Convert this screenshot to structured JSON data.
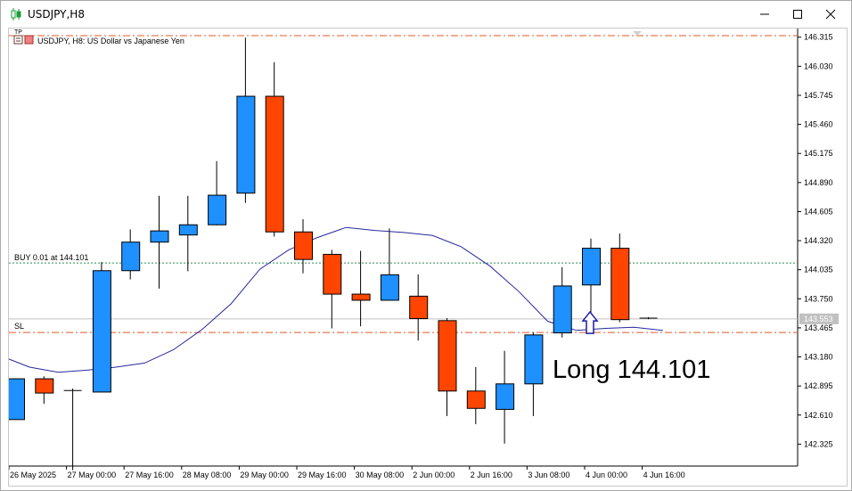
{
  "window": {
    "title": "USDJPY,H8",
    "icons": [
      "chart-candle-icon",
      "minimize-icon",
      "maximize-icon",
      "close-icon"
    ]
  },
  "chart_data": {
    "type": "candlestick",
    "symbol_info": "USDJPY, H8:  US Dollar vs Japanese Yen",
    "corner_marker": "TP",
    "colors": {
      "bull": "#1e90ff",
      "bear": "#ff4500",
      "ma_line": "#2828a0",
      "order_level": "#2e8b57",
      "sl_tp": "#e0582a",
      "current_price": "#c0c0c0"
    },
    "y_ticks": [
      "146.315",
      "146.030",
      "145.745",
      "145.460",
      "145.175",
      "144.890",
      "144.605",
      "144.320",
      "144.035",
      "143.750",
      "143.465",
      "143.180",
      "142.895",
      "142.610",
      "142.325"
    ],
    "ylim": [
      142.11,
      146.4
    ],
    "x_labels": [
      "26 May 2025",
      "27 May 00:00",
      "27 May 16:00",
      "28 May 08:00",
      "29 May 00:00",
      "29 May 16:00",
      "30 May 08:00",
      "2 Jun 00:00",
      "2 Jun 16:00",
      "3 Jun 08:00",
      "4 Jun 00:00",
      "4 Jun 16:00"
    ],
    "candles": [
      {
        "o": 142.57,
        "h": 142.97,
        "l": 142.57,
        "c": 142.97
      },
      {
        "o": 142.97,
        "h": 142.99,
        "l": 142.72,
        "c": 142.83
      },
      {
        "o": 142.84,
        "h": 142.87,
        "l": 142.07,
        "c": 142.85
      },
      {
        "o": 142.84,
        "h": 144.11,
        "l": 142.84,
        "c": 144.03
      },
      {
        "o": 144.03,
        "h": 144.43,
        "l": 143.94,
        "c": 144.31
      },
      {
        "o": 144.31,
        "h": 144.76,
        "l": 143.85,
        "c": 144.42
      },
      {
        "o": 144.38,
        "h": 144.76,
        "l": 144.02,
        "c": 144.48
      },
      {
        "o": 144.48,
        "h": 145.1,
        "l": 144.47,
        "c": 144.77
      },
      {
        "o": 144.79,
        "h": 146.31,
        "l": 144.69,
        "c": 145.74
      },
      {
        "o": 145.74,
        "h": 146.07,
        "l": 144.36,
        "c": 144.41
      },
      {
        "o": 144.41,
        "h": 144.53,
        "l": 144.0,
        "c": 144.14
      },
      {
        "o": 144.19,
        "h": 144.23,
        "l": 143.46,
        "c": 143.8
      },
      {
        "o": 143.8,
        "h": 144.22,
        "l": 143.48,
        "c": 143.74
      },
      {
        "o": 143.74,
        "h": 144.44,
        "l": 143.74,
        "c": 143.99
      },
      {
        "o": 143.78,
        "h": 143.99,
        "l": 143.34,
        "c": 143.56
      },
      {
        "o": 143.54,
        "h": 143.56,
        "l": 142.6,
        "c": 142.85
      },
      {
        "o": 142.85,
        "h": 143.08,
        "l": 142.52,
        "c": 142.68
      },
      {
        "o": 142.67,
        "h": 143.24,
        "l": 142.33,
        "c": 142.92
      },
      {
        "o": 142.92,
        "h": 143.42,
        "l": 142.6,
        "c": 143.4
      },
      {
        "o": 143.42,
        "h": 144.06,
        "l": 143.37,
        "c": 143.88
      },
      {
        "o": 143.89,
        "h": 144.34,
        "l": 143.6,
        "c": 144.25
      },
      {
        "o": 144.25,
        "h": 144.39,
        "l": 143.52,
        "c": 143.55
      },
      {
        "o": 143.55,
        "h": 143.57,
        "l": 143.55,
        "c": 143.56
      }
    ],
    "moving_average": [
      143.19,
      143.08,
      143.03,
      143.05,
      143.08,
      143.12,
      143.25,
      143.45,
      143.7,
      144.04,
      144.23,
      144.35,
      144.45,
      144.42,
      144.4,
      144.37,
      144.26,
      144.07,
      143.82,
      143.53,
      143.44,
      143.46,
      143.47,
      143.44
    ],
    "levels": {
      "order": {
        "label": "BUY 0.01 at 144.101",
        "price": 144.101
      },
      "stop_loss": {
        "label": "SL",
        "price": 143.42
      },
      "take_profit": {
        "label": "",
        "price": 146.33
      },
      "current": {
        "label": "143.553",
        "price": 143.553
      }
    },
    "entry_arrow_index": 20,
    "annotation": "Long 144.101",
    "grid": false
  }
}
